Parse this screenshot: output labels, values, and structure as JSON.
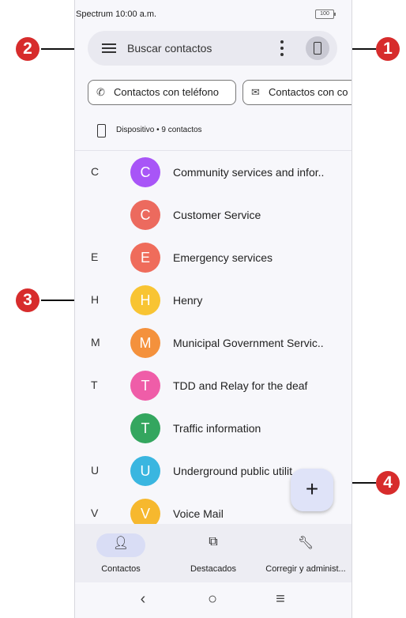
{
  "status_bar": {
    "carrier_time": "Spectrum 10:00 a.m.",
    "battery": "100"
  },
  "search": {
    "placeholder": "Buscar contactos",
    "menu_icon": "hamburger-icon",
    "more_icon": "more-vert-icon",
    "device_icon": "smartphone-icon"
  },
  "chips": [
    {
      "label": "Contactos con teléfono",
      "icon": "phone-icon"
    },
    {
      "label": "Contactos con co",
      "icon": "email-icon"
    }
  ],
  "source": {
    "label": "Dispositivo • 9 contactos",
    "icon": "smartphone-icon"
  },
  "contacts": [
    {
      "letter": "C",
      "initial": "C",
      "name": "Community services and infor..",
      "color": "#a855f7"
    },
    {
      "letter": "",
      "initial": "C",
      "name": "Customer Service",
      "color": "#ec6a5e"
    },
    {
      "letter": "E",
      "initial": "E",
      "name": "Emergency services",
      "color": "#ef6c5b"
    },
    {
      "letter": "H",
      "initial": "H",
      "name": "Henry",
      "color": "#f8c433"
    },
    {
      "letter": "M",
      "initial": "M",
      "name": "Municipal Government Servic..",
      "color": "#f4913c"
    },
    {
      "letter": "T",
      "initial": "T",
      "name": "TDD and Relay for the deaf",
      "color": "#ef5da8"
    },
    {
      "letter": "",
      "initial": "T",
      "name": "Traffic information",
      "color": "#34a65f"
    },
    {
      "letter": "U",
      "initial": "U",
      "name": "Underground public utilit",
      "color": "#3ab6e0"
    },
    {
      "letter": "V",
      "initial": "V",
      "name": "Voice Mail",
      "color": "#f6b82e"
    }
  ],
  "fab": {
    "label": "+",
    "icon": "add-icon"
  },
  "bottom_nav": [
    {
      "label": "Contactos",
      "icon": "person-icon",
      "active": true
    },
    {
      "label": "Destacados",
      "icon": "star-box-icon",
      "active": false
    },
    {
      "label": "Corregir y administ...",
      "icon": "wrench-icon",
      "active": false
    }
  ],
  "system_nav": {
    "back": "‹",
    "home": "○",
    "recents": "≡"
  },
  "callouts": [
    "1",
    "2",
    "3",
    "4"
  ],
  "colors": {
    "callout": "#d72c2c",
    "fab_bg": "#dfe3f8",
    "active_pill": "#d9ddf5"
  }
}
